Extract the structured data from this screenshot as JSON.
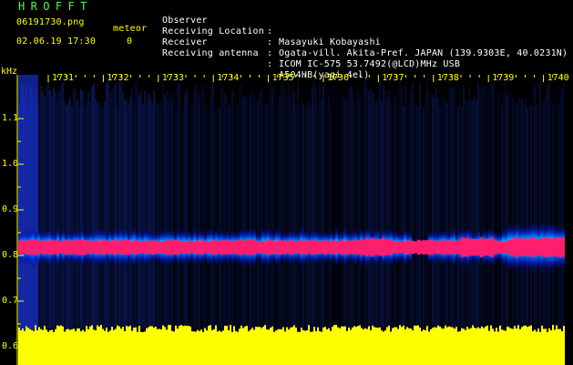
{
  "header": {
    "app_title": "HROFFT",
    "file_name": "06191730.png",
    "date_time": "02.06.19 17:30",
    "meteor_label": "meteor",
    "meteor_count": "0",
    "meta": [
      {
        "key": "Observer",
        "value": "Masayuki Kobayashi"
      },
      {
        "key": "Receiving Location",
        "value": "Ogata-vill. Akita-Pref. JAPAN (139.9303E, 40.0231N)"
      },
      {
        "key": "Receiver",
        "value": "ICOM IC-575 53.7492(@LCD)MHz USB"
      },
      {
        "key": "Receiving antenna",
        "value": "A504HB(yagi 4el)"
      }
    ]
  },
  "chart_data": {
    "type": "heatmap",
    "ylabel": "kHz",
    "x_ticks": [
      "1731",
      "1732",
      "1733",
      "1734",
      "1735",
      "1736",
      "1737",
      "1738",
      "1739",
      "1740"
    ],
    "y_ticks": [
      "1.1",
      "1.0",
      "0.9",
      "0.8",
      "0.7",
      "0.6"
    ],
    "ylim": [
      0.57,
      1.17
    ],
    "carrier_khz": 0.818,
    "noise_floor_band": "yellow",
    "colors": {
      "background": "#000000",
      "ticks": "#ffff00",
      "carrier": "#ff1e6e",
      "noise": "#ffff00",
      "halo": [
        "#0020ff",
        "#00a0ff",
        "#00ff90",
        "#a0ff00"
      ]
    }
  }
}
